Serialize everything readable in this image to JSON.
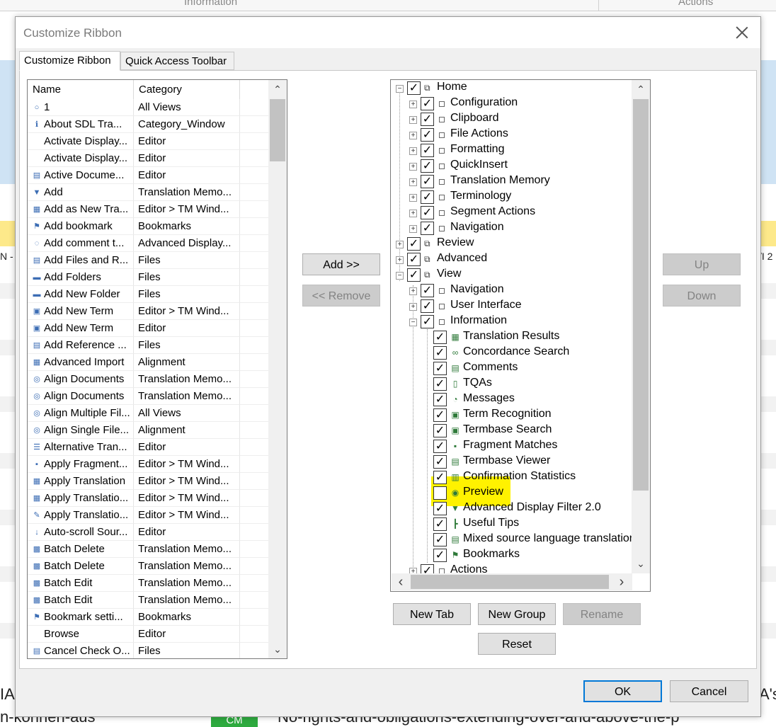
{
  "background": {
    "header_left": "Information",
    "header_right": "Actions",
    "left_fragments": [
      "N -",
      "IA",
      "n-können-aus"
    ],
    "right_fragments": [
      "/I 2",
      "A's"
    ],
    "bottom_text": "No-rights-and-obligations-extending-over-and-above-the-p",
    "cm_badge": "CM",
    "colors": {
      "blue_band": "#cfe3f4",
      "yellow_band": "#fde98a",
      "green_badge": "#2eaa3f"
    }
  },
  "dialog": {
    "title": "Customize Ribbon",
    "tabs": [
      "Customize Ribbon",
      "Quick Access Toolbar"
    ],
    "active_tab": "Customize Ribbon"
  },
  "commands": {
    "headers": [
      "Name",
      "Category"
    ],
    "rows": [
      {
        "name": "1",
        "category": "All Views",
        "icon": "blank-icon"
      },
      {
        "name": "About SDL Tra...",
        "category": "Category_Window",
        "icon": "info-icon"
      },
      {
        "name": "Activate Display...",
        "category": "Editor",
        "icon": ""
      },
      {
        "name": "Activate Display...",
        "category": "Editor",
        "icon": ""
      },
      {
        "name": "Active Docume...",
        "category": "Editor",
        "icon": "document-icon"
      },
      {
        "name": "Add",
        "category": "Translation Memo...",
        "icon": "filter-add-icon"
      },
      {
        "name": "Add as New Tra...",
        "category": "Editor > TM Wind...",
        "icon": "tm-add-icon"
      },
      {
        "name": "Add bookmark",
        "category": "Bookmarks",
        "icon": "bookmark-icon"
      },
      {
        "name": "Add comment t...",
        "category": "Advanced Display...",
        "icon": "comment-icon"
      },
      {
        "name": "Add Files and R...",
        "category": "Files",
        "icon": "file-add-icon"
      },
      {
        "name": "Add Folders",
        "category": "Files",
        "icon": "folder-icon"
      },
      {
        "name": "Add New Folder",
        "category": "Files",
        "icon": "folder-icon"
      },
      {
        "name": "Add New Term",
        "category": "Editor > TM Wind...",
        "icon": "term-icon"
      },
      {
        "name": "Add New Term",
        "category": "Editor",
        "icon": "term-icon"
      },
      {
        "name": "Add Reference ...",
        "category": "Files",
        "icon": "file-add-icon"
      },
      {
        "name": "Advanced Import",
        "category": "Alignment",
        "icon": "import-icon"
      },
      {
        "name": "Align Documents",
        "category": "Translation Memo...",
        "icon": "align-icon"
      },
      {
        "name": "Align Documents",
        "category": "Translation Memo...",
        "icon": "align-icon"
      },
      {
        "name": "Align Multiple Fil...",
        "category": "All Views",
        "icon": "align-icon"
      },
      {
        "name": "Align Single File...",
        "category": "Alignment",
        "icon": "align-icon"
      },
      {
        "name": "Alternative Tran...",
        "category": "Editor",
        "icon": "list-icon"
      },
      {
        "name": "Apply Fragment...",
        "category": "Editor > TM Wind...",
        "icon": "fragment-icon"
      },
      {
        "name": "Apply Translation",
        "category": "Editor > TM Wind...",
        "icon": "tm-add-icon"
      },
      {
        "name": "Apply Translatio...",
        "category": "Editor > TM Wind...",
        "icon": "tm-add-icon"
      },
      {
        "name": "Apply Translatio...",
        "category": "Editor > TM Wind...",
        "icon": "tools-icon"
      },
      {
        "name": "Auto-scroll Sour...",
        "category": "Editor",
        "icon": "arrows-down-icon"
      },
      {
        "name": "Batch Delete",
        "category": "Translation Memo...",
        "icon": "batch-icon"
      },
      {
        "name": "Batch Delete",
        "category": "Translation Memo...",
        "icon": "batch-icon"
      },
      {
        "name": "Batch Edit",
        "category": "Translation Memo...",
        "icon": "batch-icon"
      },
      {
        "name": "Batch Edit",
        "category": "Translation Memo...",
        "icon": "batch-icon"
      },
      {
        "name": "Bookmark setti...",
        "category": "Bookmarks",
        "icon": "bookmark-settings-icon"
      },
      {
        "name": "Browse",
        "category": "Editor",
        "icon": ""
      },
      {
        "name": "Cancel Check O...",
        "category": "Files",
        "icon": "file-cancel-icon"
      }
    ]
  },
  "middle_buttons": {
    "add": "Add >>",
    "remove": "<< Remove"
  },
  "order_buttons": {
    "up": "Up",
    "down": "Down"
  },
  "tree": {
    "nodes": [
      {
        "level": 0,
        "label": "Home",
        "expander": "minus",
        "checked": true,
        "kind": "tab"
      },
      {
        "level": 1,
        "label": "Configuration",
        "expander": "plus",
        "checked": true,
        "kind": "group"
      },
      {
        "level": 1,
        "label": "Clipboard",
        "expander": "plus",
        "checked": true,
        "kind": "group"
      },
      {
        "level": 1,
        "label": "File Actions",
        "expander": "plus",
        "checked": true,
        "kind": "group"
      },
      {
        "level": 1,
        "label": "Formatting",
        "expander": "plus",
        "checked": true,
        "kind": "group"
      },
      {
        "level": 1,
        "label": "QuickInsert",
        "expander": "plus",
        "checked": true,
        "kind": "group"
      },
      {
        "level": 1,
        "label": "Translation Memory",
        "expander": "plus",
        "checked": true,
        "kind": "group"
      },
      {
        "level": 1,
        "label": "Terminology",
        "expander": "plus",
        "checked": true,
        "kind": "group"
      },
      {
        "level": 1,
        "label": "Segment Actions",
        "expander": "plus",
        "checked": true,
        "kind": "group"
      },
      {
        "level": 1,
        "label": "Navigation",
        "expander": "plus",
        "checked": true,
        "kind": "group"
      },
      {
        "level": 0,
        "label": "Review",
        "expander": "plus",
        "checked": true,
        "kind": "tab"
      },
      {
        "level": 0,
        "label": "Advanced",
        "expander": "plus",
        "checked": true,
        "kind": "tab"
      },
      {
        "level": 0,
        "label": "View",
        "expander": "minus",
        "checked": true,
        "kind": "tab"
      },
      {
        "level": 1,
        "label": "Navigation",
        "expander": "plus",
        "checked": true,
        "kind": "group"
      },
      {
        "level": 1,
        "label": "User Interface",
        "expander": "plus",
        "checked": true,
        "kind": "group"
      },
      {
        "level": 1,
        "label": "Information",
        "expander": "minus",
        "checked": true,
        "kind": "group"
      },
      {
        "level": 2,
        "label": "Translation Results",
        "checked": true,
        "icon": "results-icon"
      },
      {
        "level": 2,
        "label": "Concordance Search",
        "checked": true,
        "icon": "binoculars-icon"
      },
      {
        "level": 2,
        "label": "Comments",
        "checked": true,
        "icon": "comments-icon"
      },
      {
        "level": 2,
        "label": "TQAs",
        "checked": true,
        "icon": "tqa-icon"
      },
      {
        "level": 2,
        "label": "Messages",
        "checked": true,
        "icon": "messages-icon"
      },
      {
        "level": 2,
        "label": "Term Recognition",
        "checked": true,
        "icon": "term-icon"
      },
      {
        "level": 2,
        "label": "Termbase Search",
        "checked": true,
        "icon": "term-icon"
      },
      {
        "level": 2,
        "label": "Fragment Matches",
        "checked": true,
        "icon": "fragment-icon"
      },
      {
        "level": 2,
        "label": "Termbase Viewer",
        "checked": true,
        "icon": "viewer-icon"
      },
      {
        "level": 2,
        "label": "Confirmation Statistics",
        "checked": true,
        "icon": "stats-icon"
      },
      {
        "level": 2,
        "label": "Preview",
        "checked": false,
        "icon": "eye-icon",
        "highlighted": true
      },
      {
        "level": 2,
        "label": "Advanced Display Filter 2.0",
        "checked": true,
        "icon": "filter-icon"
      },
      {
        "level": 2,
        "label": "Useful Tips",
        "checked": true,
        "icon": "tips-icon"
      },
      {
        "level": 2,
        "label": "Mixed source language translation",
        "checked": true,
        "icon": "document-icon"
      },
      {
        "level": 2,
        "label": "Bookmarks",
        "checked": true,
        "icon": "bookmark-icon"
      },
      {
        "level": 1,
        "label": "Actions",
        "expander": "plus",
        "checked": true,
        "kind": "group"
      }
    ]
  },
  "tree_buttons": {
    "new_tab": "New Tab",
    "new_group": "New Group",
    "rename": "Rename",
    "reset": "Reset"
  },
  "footer": {
    "ok": "OK",
    "cancel": "Cancel"
  },
  "glyphs": {
    "check": "✓",
    "plus": "+",
    "minus": "−",
    "up": "⌃",
    "down": "⌄",
    "left": "‹",
    "right": "›"
  },
  "colors": {
    "highlight": "#fff200",
    "primary_border": "#0078d7"
  }
}
